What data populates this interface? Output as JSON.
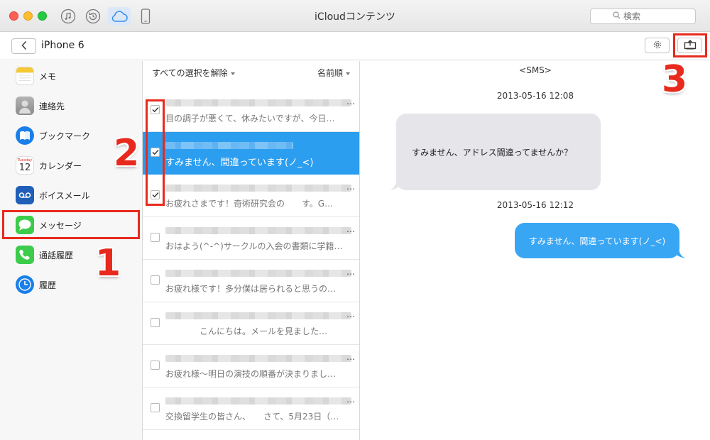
{
  "window": {
    "title": "iCloudコンテンツ"
  },
  "toolbar": {
    "icons": [
      "music-icon",
      "restore-icon",
      "icloud-icon",
      "phone-icon"
    ],
    "search_placeholder": "検索"
  },
  "device": {
    "name": "iPhone 6"
  },
  "sidebar": {
    "items": [
      {
        "label": "メモ",
        "icon": "notes-icon"
      },
      {
        "label": "連絡先",
        "icon": "contacts-icon"
      },
      {
        "label": "ブックマーク",
        "icon": "bookmark-icon"
      },
      {
        "label": "カレンダー",
        "icon": "calendar-icon",
        "icon_text_top": "Tuesday",
        "icon_text_day": "12"
      },
      {
        "label": "ボイスメール",
        "icon": "voicemail-icon"
      },
      {
        "label": "メッセージ",
        "icon": "messages-icon",
        "selected": true
      },
      {
        "label": "通話履歴",
        "icon": "phone-icon"
      },
      {
        "label": "履歴",
        "icon": "history-icon"
      }
    ]
  },
  "list": {
    "deselect_label": "すべての選択を解除",
    "sort_label": "名前順",
    "items": [
      {
        "preview": "目の調子が悪くて、休みたいですが、今日…",
        "checked": true,
        "selected": false
      },
      {
        "preview": "すみません、間違っています(ノ_<)",
        "checked": true,
        "selected": true
      },
      {
        "preview": "お疲れさまです！奇術研究会の　　す。G…",
        "checked": true,
        "selected": false
      },
      {
        "preview": "おはよう(^-^)サークルの入会の書類に学籍…",
        "checked": false,
        "selected": false
      },
      {
        "preview": "お疲れ様です！多分僕は居られると思うの…",
        "checked": false,
        "selected": false
      },
      {
        "preview": "　　　　こんにちは。メールを見ました…",
        "checked": false,
        "selected": false
      },
      {
        "preview": "お疲れ様〜明日の演技の順番が決まりまし…",
        "checked": false,
        "selected": false
      },
      {
        "preview": "交換留学生の皆さん、　　さて、5月23日（…",
        "checked": false,
        "selected": false
      }
    ],
    "ellipsis": "…"
  },
  "detail": {
    "tag": "<SMS>",
    "messages": [
      {
        "timestamp": "2013-05-16 12:08",
        "text": "すみません、アドレス間違ってませんか？",
        "direction": "incoming"
      },
      {
        "timestamp": "2013-05-16 12:12",
        "text": "すみません、間違っています(ノ_<)",
        "direction": "outgoing"
      }
    ]
  },
  "annotations": {
    "step1": "1",
    "step2": "2",
    "step3": "3"
  },
  "colors": {
    "accent": "#2c9ef0",
    "annotation_red": "#e8291d",
    "incoming_bubble": "#e5e5ea",
    "outgoing_bubble": "#39a6f4"
  }
}
